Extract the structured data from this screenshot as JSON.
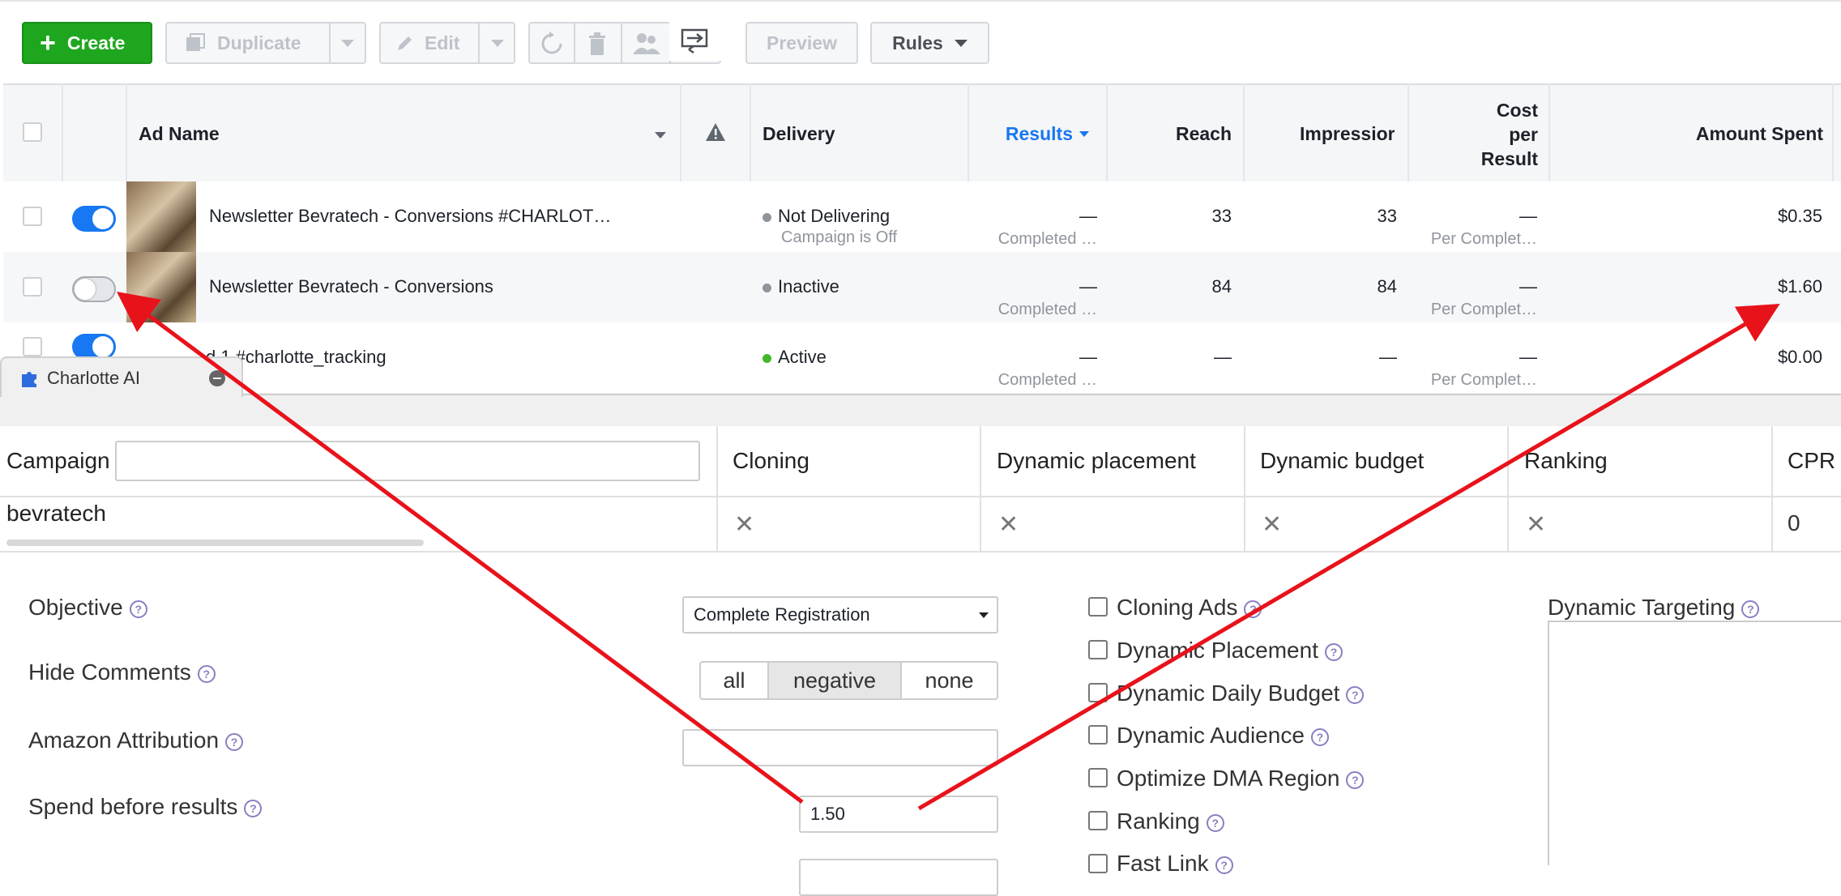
{
  "toolbar": {
    "create_label": "Create",
    "duplicate_label": "Duplicate",
    "edit_label": "Edit",
    "preview_label": "Preview",
    "rules_label": "Rules"
  },
  "grid": {
    "headers": {
      "ad_name": "Ad Name",
      "delivery": "Delivery",
      "results": "Results",
      "reach": "Reach",
      "impressions": "Impressior",
      "cost_line1": "Cost",
      "cost_line2": "per",
      "cost_line3": "Result",
      "amount_spent": "Amount Spent"
    },
    "rows": [
      {
        "name": "Newsletter Bevratech - Conversions #CHARLOT…",
        "delivery": "Not Delivering",
        "delivery_sub": "Campaign is Off",
        "results": "—",
        "results_sub": "Completed …",
        "reach": "33",
        "impressions": "33",
        "cost": "—",
        "cost_sub": "Per Complet…",
        "spent": "$0.35"
      },
      {
        "name": "Newsletter Bevratech - Conversions",
        "delivery": "Inactive",
        "delivery_sub": "",
        "results": "—",
        "results_sub": "Completed …",
        "reach": "84",
        "impressions": "84",
        "cost": "—",
        "cost_sub": "Per Complet…",
        "spent": "$1.60"
      },
      {
        "name": "d 1 #charlotte_tracking",
        "delivery": "Active",
        "delivery_sub": "",
        "results": "—",
        "results_sub": "Completed …",
        "reach": "—",
        "impressions": "—",
        "cost": "—",
        "cost_sub": "Per Complet…",
        "spent": "$0.00"
      }
    ]
  },
  "charlotte": {
    "tab_label": "Charlotte AI",
    "table": {
      "campaign_label": "Campaign",
      "campaign_value": "bevratech",
      "cloning": "Cloning",
      "dynamic_placement": "Dynamic placement",
      "dynamic_budget": "Dynamic budget",
      "ranking": "Ranking",
      "cpr": "CPR",
      "cpr_value": "0",
      "x": "✕"
    },
    "form": {
      "objective_label": "Objective",
      "objective_value": "Complete Registration",
      "hide_comments_label": "Hide Comments",
      "hide_all": "all",
      "hide_negative": "negative",
      "hide_none": "none",
      "amazon_label": "Amazon Attribution",
      "spend_label": "Spend before results",
      "spend_value": "1.50",
      "checkboxes": {
        "cloning_ads": "Cloning Ads",
        "dynamic_placement": "Dynamic Placement",
        "dynamic_daily_budget": "Dynamic Daily Budget",
        "dynamic_audience": "Dynamic Audience",
        "optimize_dma": "Optimize DMA Region",
        "ranking": "Ranking",
        "fast_link": "Fast Link"
      },
      "dynamic_targeting_label": "Dynamic Targeting",
      "help": "?"
    }
  },
  "colors": {
    "accent": "#1877f2",
    "create": "#1ea61e",
    "arrow": "#e8121b",
    "results_header": "#1877f2"
  }
}
